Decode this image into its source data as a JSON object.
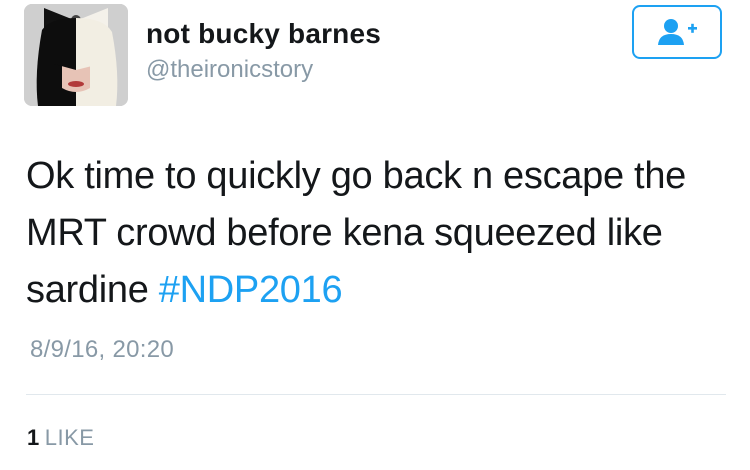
{
  "author": {
    "display_name": "not bucky barnes",
    "handle": "@theironicstory",
    "avatar": "profile-avatar"
  },
  "follow_button": {
    "icon": "follow-user-icon",
    "color": "#1da1f2"
  },
  "tweet": {
    "text": "Ok time to quickly go back n escape the MRT crowd before kena squeezed like sardine ",
    "hashtag": "#NDP2016",
    "timestamp": "8/9/16, 20:20"
  },
  "stats": {
    "likes_count": "1",
    "likes_label": "LIKE"
  },
  "colors": {
    "accent": "#1da1f2",
    "text": "#14171a",
    "muted": "#8899a6",
    "divider": "#e1e8ed"
  }
}
